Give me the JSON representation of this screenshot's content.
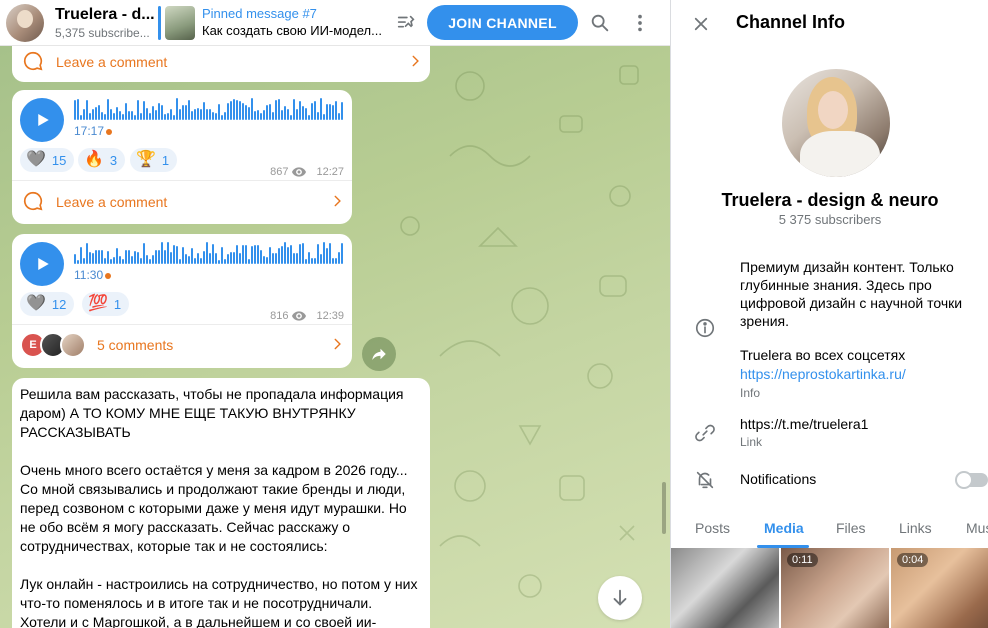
{
  "header": {
    "title": "Truelera - d...",
    "subscribers": "5,375 subscribe...",
    "pinned_title": "Pinned message #7",
    "pinned_text": "Как создать свою ИИ-модел...",
    "join_label": "JOIN CHANNEL"
  },
  "messages": {
    "top_comment_label": "Leave a comment",
    "voice1": {
      "duration": "17:17",
      "reactions": [
        {
          "emoji": "🩶",
          "count": "15"
        },
        {
          "emoji": "🔥",
          "count": "3"
        },
        {
          "emoji": "🏆",
          "count": "1"
        }
      ],
      "views": "867",
      "time": "12:27",
      "comment_label": "Leave a comment"
    },
    "voice2": {
      "duration": "11:30",
      "reactions": [
        {
          "emoji": "🩶",
          "count": "12"
        },
        {
          "emoji": "💯",
          "count": "1"
        }
      ],
      "views": "816",
      "time": "12:39",
      "commenter_initial": "E",
      "comment_label": "5 comments"
    },
    "text_post": {
      "paragraphs": [
        "Решила вам рассказать, чтобы не пропадала информация даром) А ТО КОМУ МНЕ ЕЩЕ ТАКУЮ ВНУТРЯНКУ РАССКАЗЫВАТЬ",
        "Очень много всего остаётся у меня за кадром в 2026 году... Со мной связывались и продолжают такие бренды и люди, перед созвоном с которыми даже у меня идут мурашки. Но не обо всём я могу рассказать. Сейчас расскажу о сотрудничествах, которые так и не состоялись:",
        "Лук онлайн - настроились на сотрудничество, но потом у них что-то поменялось и в итоге так и не посотрудничали. Хотели и с Маргошкой, а в дальнейшем и со своей ии-"
      ]
    }
  },
  "panel": {
    "title": "Channel Info",
    "name": "Truelera - design & neuro",
    "subscribers": "5 375 subscribers",
    "description": "Премиум дизайн контент. Только глубинные знания. Здесь про цифровой дизайн с научной точки зрения.",
    "description_line2": "Truelera во всех соцсетях",
    "description_link": "https://neprostokartinka.ru/",
    "info_caption": "Info",
    "link": "https://t.me/truelera1",
    "link_caption": "Link",
    "notifications_label": "Notifications",
    "notifications_on": false,
    "tabs": [
      "Posts",
      "Media",
      "Files",
      "Links",
      "Music"
    ],
    "active_tab": "Media",
    "media": [
      {
        "duration": ""
      },
      {
        "duration": "0:11"
      },
      {
        "duration": "0:04"
      }
    ]
  },
  "colors": {
    "accent": "#3390ec",
    "comment_orange": "#e8761f",
    "chat_bg": "#b8cd93"
  }
}
